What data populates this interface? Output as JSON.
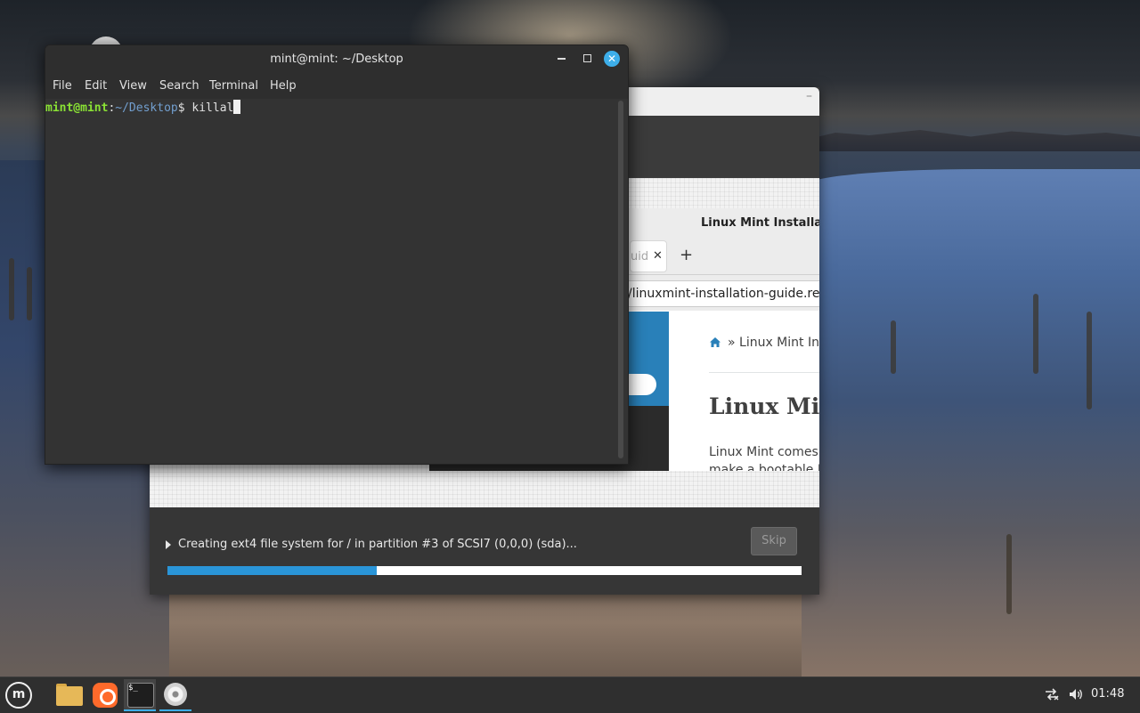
{
  "terminal": {
    "title": "mint@mint: ~/Desktop",
    "menu": [
      "File",
      "Edit",
      "View",
      "Search",
      "Terminal",
      "Help"
    ],
    "prompt_user": "mint@mint",
    "prompt_sep": ":",
    "prompt_path": "~/Desktop",
    "prompt_symbol": "$ ",
    "command": "killal",
    "close_glyph": "✕"
  },
  "installer": {
    "status": "Creating ext4 file system for / in partition #3 of SCSI7 (0,0,0) (sda)...",
    "skip_label": "Skip",
    "progress_percent": 33,
    "minimize_glyph": "–"
  },
  "browser": {
    "window_title": "Linux Mint Installatio",
    "tab_label": "uid",
    "tab_close": "✕",
    "new_tab": "+",
    "url": "/linuxmint-installation-guide.readt",
    "sidebar_text": "de",
    "breadcrumb": "» Linux Mint Inst",
    "heading": "Linux Min",
    "paragraph_line1": "Linux Mint comes ir",
    "paragraph_line2": "make a bootable DV"
  },
  "taskbar": {
    "clock": "01:48",
    "menu_logo": "m",
    "terminal_icon_text": "$_"
  },
  "colors": {
    "accent": "#3daee9",
    "progress": "#2a95d8",
    "prompt_user": "#8ae234",
    "prompt_path": "#729fcf"
  }
}
